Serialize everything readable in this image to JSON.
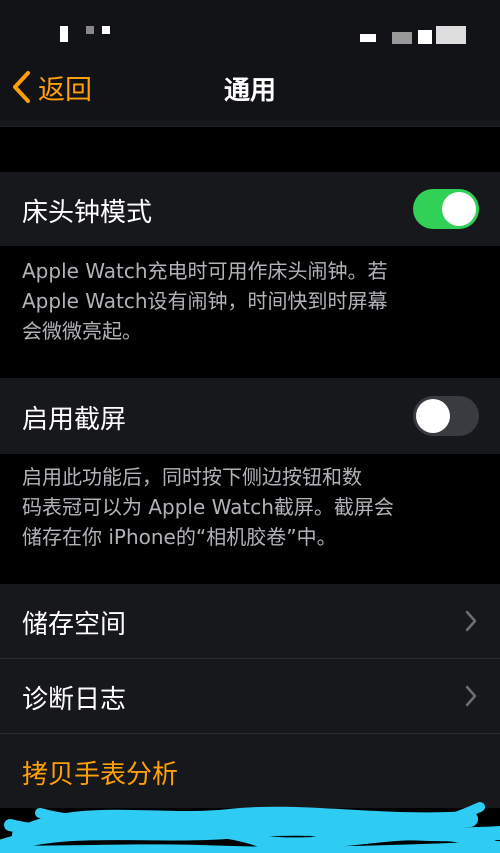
{
  "nav": {
    "back_label": "返回",
    "title": "通用"
  },
  "sections": {
    "nightstand": {
      "label": "床头钟模式",
      "toggle_on": true,
      "footer": [
        "Apple Watch充电时可用作床头闹钟。若",
        "Apple Watch设有闹钟，时间快到时屏幕",
        "会微微亮起。"
      ]
    },
    "screenshot": {
      "label": "启用截屏",
      "toggle_on": false,
      "footer": [
        "启用此功能后，同时按下侧边按钮和数",
        "码表冠可以为 Apple Watch截屏。截屏会",
        "储存在你 iPhone的“相机胶卷”中。"
      ]
    },
    "storage": {
      "label": "储存空间"
    },
    "diagnostics": {
      "label": "诊断日志"
    },
    "copy_analytics": {
      "label": "拷贝手表分析"
    }
  },
  "colors": {
    "accent": "#ff9f0a",
    "toggle_on": "#31d158",
    "toggle_off": "#3a3b40",
    "scribble": "#2ecbf2"
  },
  "icons": {
    "back": "chevron-left-icon",
    "disclosure": "chevron-right-icon"
  }
}
